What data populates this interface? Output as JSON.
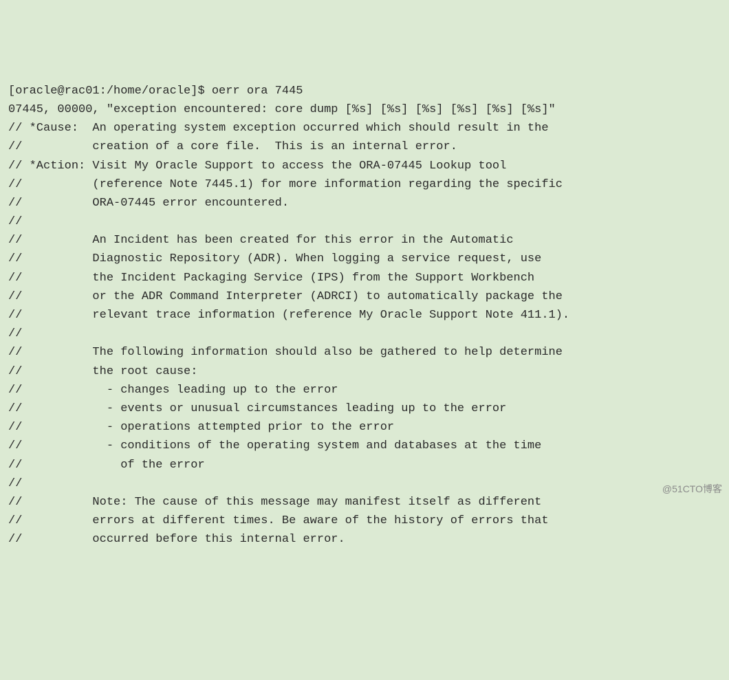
{
  "terminal": {
    "lines": [
      "[oracle@rac01:/home/oracle]$ oerr ora 7445",
      "07445, 00000, \"exception encountered: core dump [%s] [%s] [%s] [%s] [%s] [%s]\"",
      "// *Cause:  An operating system exception occurred which should result in the",
      "//          creation of a core file.  This is an internal error.",
      "// *Action: Visit My Oracle Support to access the ORA-07445 Lookup tool",
      "//          (reference Note 7445.1) for more information regarding the specific",
      "//          ORA-07445 error encountered.",
      "//",
      "//          An Incident has been created for this error in the Automatic",
      "//          Diagnostic Repository (ADR). When logging a service request, use",
      "//          the Incident Packaging Service (IPS) from the Support Workbench",
      "//          or the ADR Command Interpreter (ADRCI) to automatically package the",
      "//          relevant trace information (reference My Oracle Support Note 411.1).",
      "//",
      "//          The following information should also be gathered to help determine",
      "//          the root cause:",
      "//            - changes leading up to the error",
      "//            - events or unusual circumstances leading up to the error",
      "//            - operations attempted prior to the error",
      "//            - conditions of the operating system and databases at the time",
      "//              of the error",
      "//",
      "//          Note: The cause of this message may manifest itself as different",
      "//          errors at different times. Be aware of the history of errors that",
      "//          occurred before this internal error."
    ]
  },
  "watermark": {
    "text": "@51CTO博客"
  }
}
